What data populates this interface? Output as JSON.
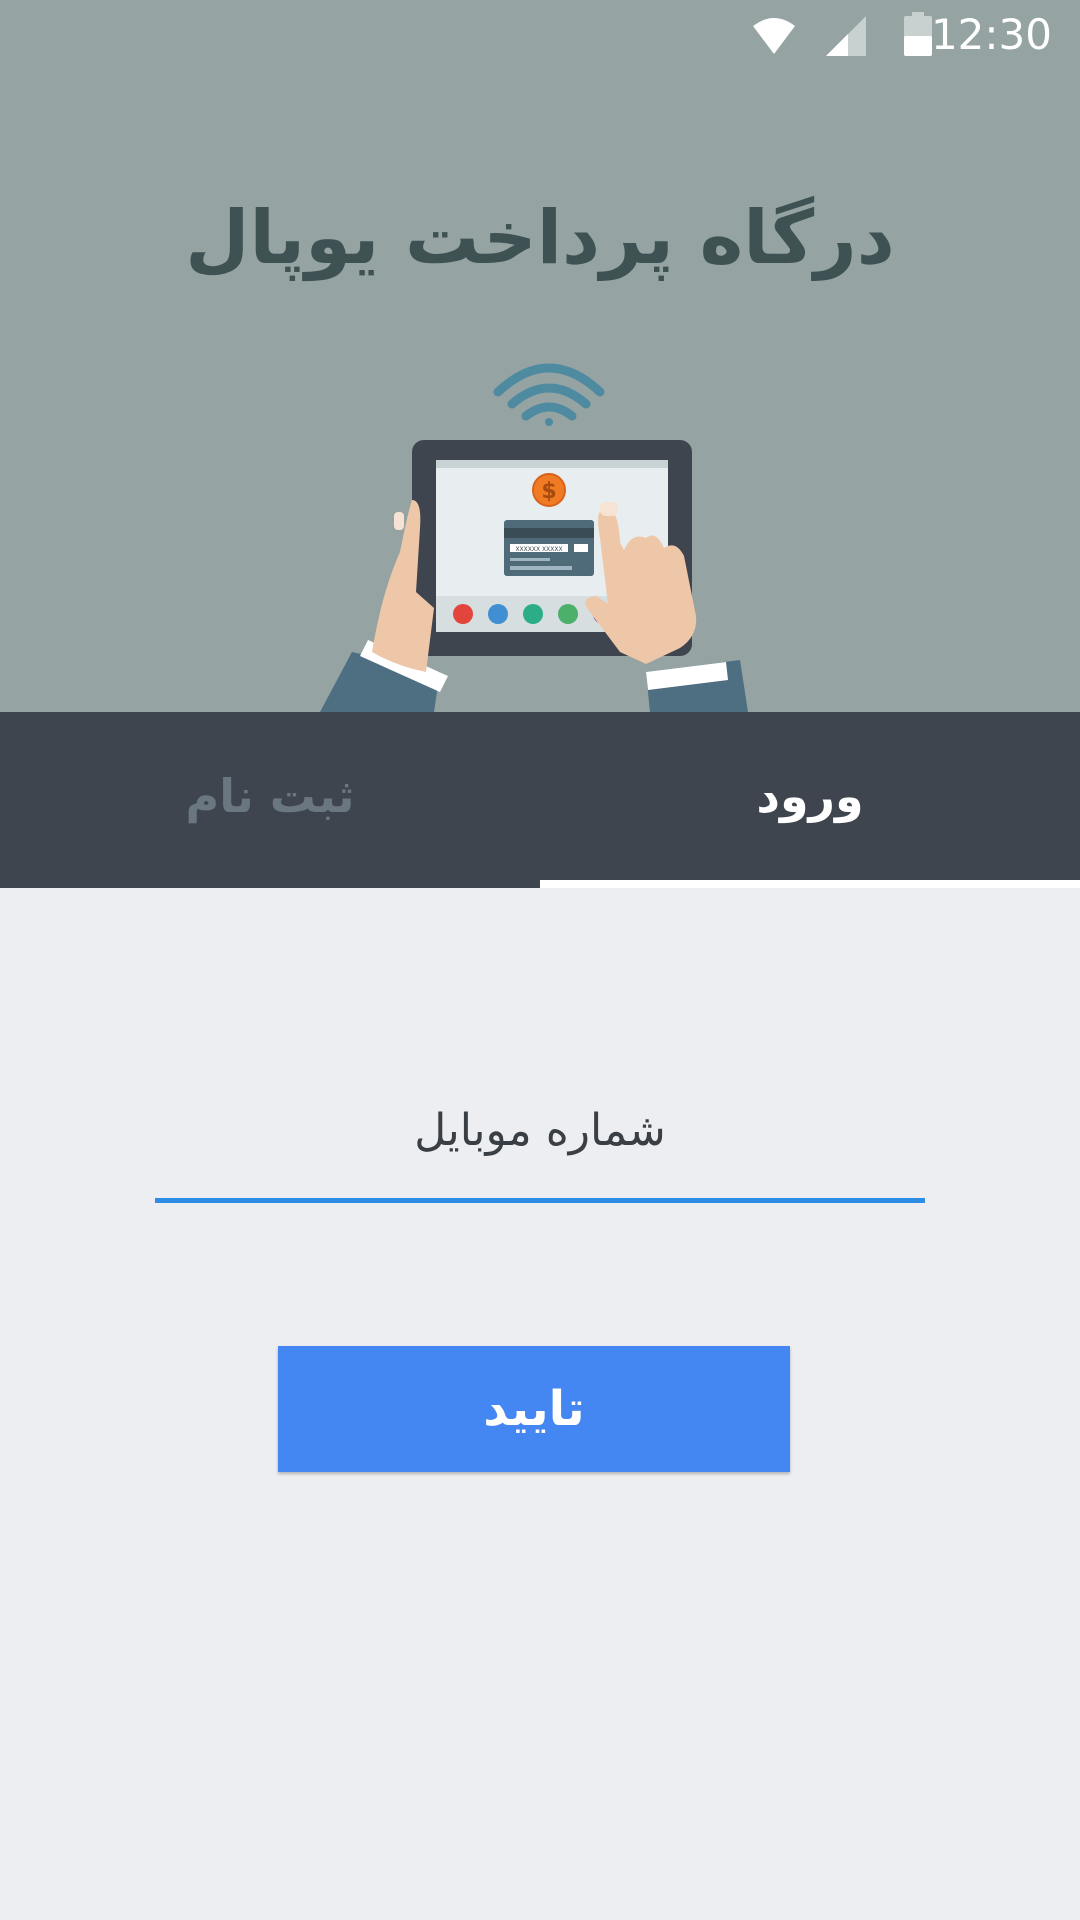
{
  "status_bar": {
    "time": "12:30",
    "icons": [
      "wifi-icon",
      "cell-signal-icon",
      "battery-icon"
    ]
  },
  "header": {
    "title": "درگاه پرداخت یوپال",
    "illustration": {
      "icons": [
        "wireless-icon",
        "tablet-icon",
        "dollar-coin-icon",
        "credit-card-icon",
        "hand-icon"
      ],
      "card_text": "XXXXXX XXXXX",
      "coin_symbol": "$"
    }
  },
  "tabs": [
    {
      "label": "ورود",
      "selected": true
    },
    {
      "label": "ثبت نام",
      "selected": false
    }
  ],
  "form": {
    "mobile_placeholder": "شماره موبایل",
    "mobile_value": "",
    "submit_label": "تایید"
  },
  "colors": {
    "header_bg": "#95A3A3",
    "title": "#3F5253",
    "tab_bar_bg": "#3E454E",
    "tab_active": "#FFFFFF",
    "tab_inactive": "#6B7780",
    "body_bg": "#ECEEF1",
    "field_underline": "#2F8CE6",
    "button_bg": "#4587F2"
  }
}
